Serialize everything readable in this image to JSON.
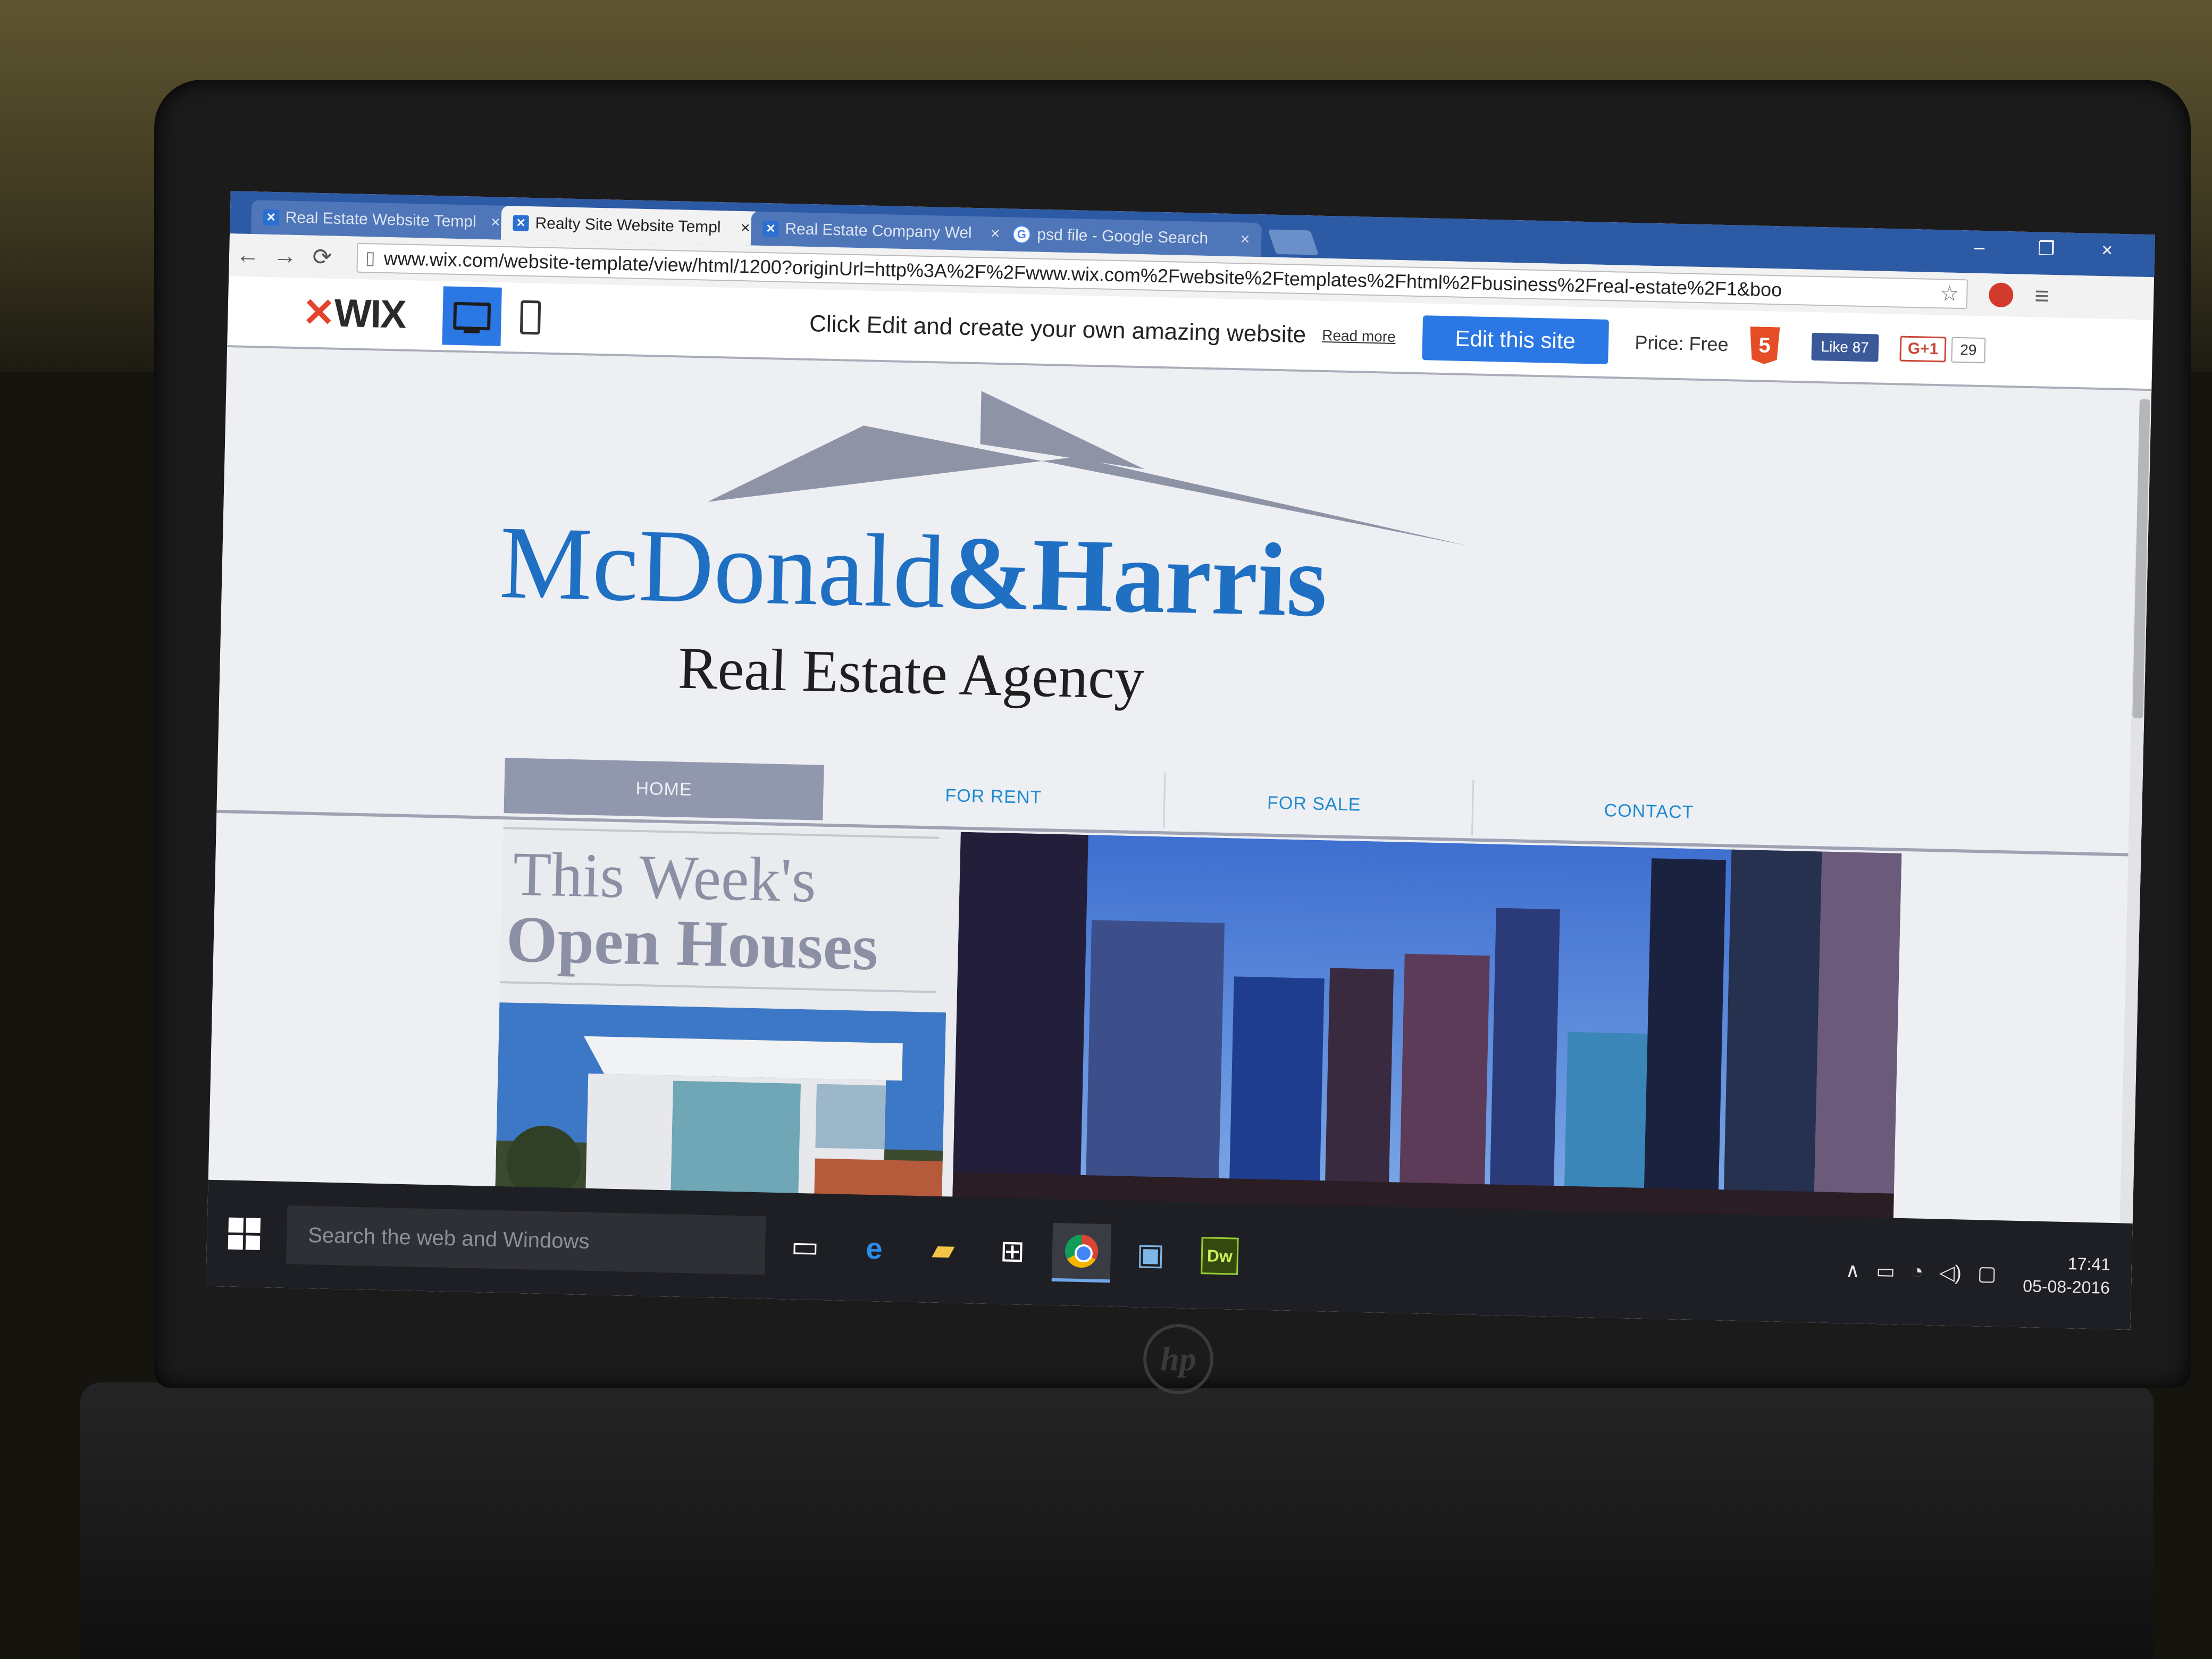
{
  "browser": {
    "tabs": [
      {
        "label": "Real Estate Website Templ",
        "icon": "wix-favicon",
        "close": "×"
      },
      {
        "label": "Realty Site Website Templ",
        "icon": "wix-favicon",
        "close": "×"
      },
      {
        "label": "Real Estate Company Wel",
        "icon": "wix-favicon",
        "close": "×"
      },
      {
        "label": "psd file - Google Search",
        "icon": "google-favicon",
        "close": "×"
      }
    ],
    "url": "www.wix.com/website-template/view/html/1200?originUrl=http%3A%2F%2Fwww.wix.com%2Fwebsite%2Ftemplates%2Fhtml%2Fbusiness%2Freal-estate%2F1&boo",
    "nav": {
      "back": "←",
      "forward": "→",
      "reload": "⟳"
    },
    "window_controls": {
      "minimize": "–",
      "restore": "❐",
      "close": "×"
    }
  },
  "wix_bar": {
    "logo_mark": "✕",
    "logo_text": "WIX",
    "promo": "Click Edit and create your own amazing website",
    "read_more": "Read more",
    "edit_button": "Edit this site",
    "price": "Price: Free",
    "html5": "5",
    "fb_like": "Like 87",
    "gplus": "G+1",
    "gplus_count": "29"
  },
  "site": {
    "brand_part1": "McDonald",
    "brand_part2": "&Harris",
    "tagline": "Real Estate Agency",
    "nav": [
      "HOME",
      "FOR RENT",
      "FOR SALE",
      "CONTACT"
    ],
    "open_houses_line1": "This Week's",
    "open_houses_line2": "Open Houses",
    "colors": {
      "brand_blue": "#1f6fc3",
      "nav_active": "#9197ad",
      "nav_text": "#1f8ad0"
    }
  },
  "taskbar": {
    "search_placeholder": "Search the web and Windows",
    "pinned": [
      "task-view-icon",
      "edge-icon",
      "file-explorer-icon",
      "store-icon",
      "chrome-icon",
      "photos-icon",
      "dreamweaver-icon"
    ],
    "dreamweaver_label": "Dw",
    "edge_label": "e",
    "time": "17:41",
    "date": "05-08-2016"
  },
  "hardware": {
    "brand": "hp"
  }
}
